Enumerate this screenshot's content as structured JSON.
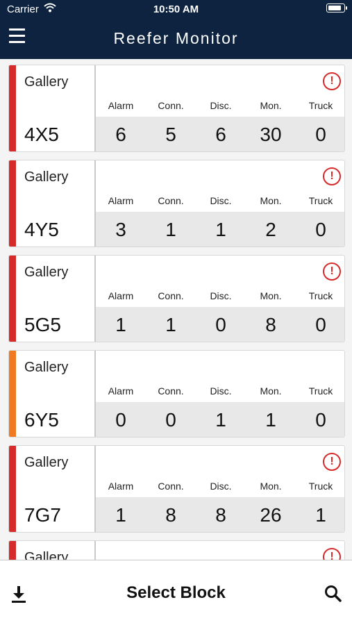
{
  "status_bar": {
    "carrier": "Carrier",
    "time": "10:50 AM"
  },
  "header": {
    "title": "Reefer Monitor"
  },
  "columns": [
    "Alarm",
    "Conn.",
    "Disc.",
    "Mon.",
    "Truck"
  ],
  "colors": {
    "navy": "#0d2340",
    "alarm_red": "#d62b2b",
    "warning_orange": "#f07a22"
  },
  "cards": [
    {
      "gallery": "Gallery",
      "block": "4X5",
      "status": "red",
      "alert": true,
      "values": [
        "6",
        "5",
        "6",
        "30",
        "0"
      ]
    },
    {
      "gallery": "Gallery",
      "block": "4Y5",
      "status": "red",
      "alert": true,
      "values": [
        "3",
        "1",
        "1",
        "2",
        "0"
      ]
    },
    {
      "gallery": "Gallery",
      "block": "5G5",
      "status": "red",
      "alert": true,
      "values": [
        "1",
        "1",
        "0",
        "8",
        "0"
      ]
    },
    {
      "gallery": "Gallery",
      "block": "6Y5",
      "status": "orange",
      "alert": false,
      "values": [
        "0",
        "0",
        "1",
        "1",
        "0"
      ]
    },
    {
      "gallery": "Gallery",
      "block": "7G7",
      "status": "red",
      "alert": true,
      "values": [
        "1",
        "8",
        "8",
        "26",
        "1"
      ]
    },
    {
      "gallery": "Gallery",
      "block": "",
      "status": "red",
      "alert": true,
      "values": [
        "",
        "",
        "",
        "",
        ""
      ]
    }
  ],
  "bottom_bar": {
    "select_label": "Select Block",
    "download_icon": "download-icon",
    "search_icon": "search-icon"
  }
}
